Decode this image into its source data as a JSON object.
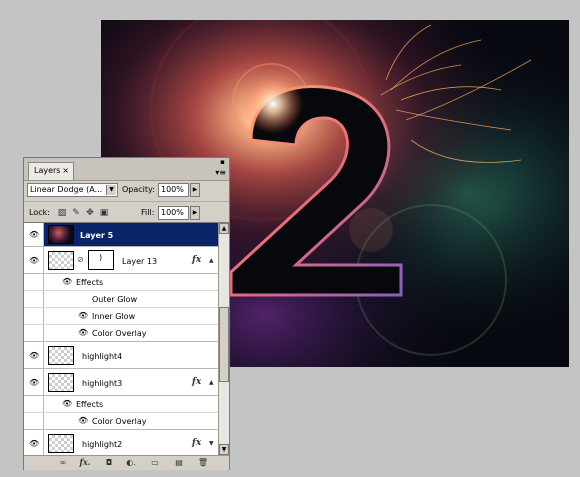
{
  "panel": {
    "tab_label": "Layers",
    "tab_close": "×",
    "blend_mode": "Linear Dodge (A...",
    "opacity_label": "Opacity:",
    "opacity_value": "100%",
    "lock_label": "Lock:",
    "fill_label": "Fill:",
    "fill_value": "100%"
  },
  "layers": [
    {
      "name": "Layer 5",
      "selected": true
    },
    {
      "name": "Layer 13",
      "fx": "fx",
      "effects_label": "Effects",
      "effects": [
        "Outer Glow",
        "Inner Glow",
        "Color Overlay"
      ]
    },
    {
      "name": "highlight4"
    },
    {
      "name": "highlight3",
      "fx": "fx",
      "effects_label": "Effects",
      "effects": [
        "Color Overlay"
      ]
    },
    {
      "name": "highlight2",
      "fx": "fx"
    }
  ],
  "icons": {
    "visibility": "eye-icon",
    "link": "chain-link-icon",
    "menu": "panel-menu-icon"
  },
  "colors": {
    "selection": "#0a246a",
    "panel_bg": "#d4d0c8",
    "app_bg": "#c4c4c4"
  }
}
